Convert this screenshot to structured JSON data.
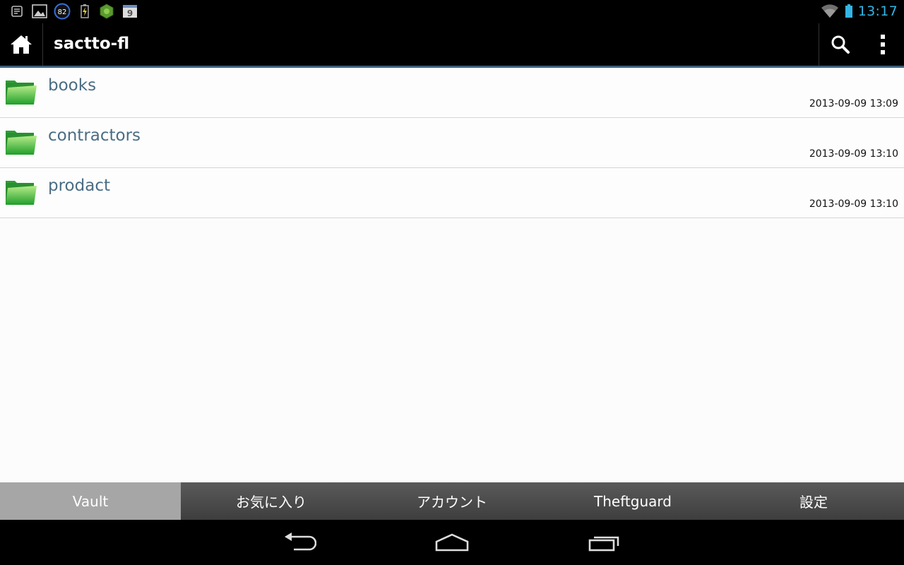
{
  "status_bar": {
    "icons": [
      "list-notification-icon",
      "image-notification-icon",
      "circle-82-icon",
      "battery-charging-icon",
      "app-green-icon",
      "calendar-icon"
    ],
    "badge_value": "82",
    "calendar_day": "9",
    "clock": "13:17",
    "accent": "#33b5e5"
  },
  "action_bar": {
    "title": "sactto-fl"
  },
  "files": [
    {
      "name": "books",
      "date": "2013-09-09 13:09"
    },
    {
      "name": "contractors",
      "date": "2013-09-09 13:10"
    },
    {
      "name": "prodact",
      "date": "2013-09-09 13:10"
    }
  ],
  "tabs": [
    {
      "label": "Vault",
      "active": true
    },
    {
      "label": "お気に入り",
      "active": false
    },
    {
      "label": "アカウント",
      "active": false
    },
    {
      "label": "Theftguard",
      "active": false
    },
    {
      "label": "設定",
      "active": false
    }
  ],
  "colors": {
    "folder_green": "#3cbf3c",
    "file_name": "#4a6d83",
    "active_tab": "#a6a6a6"
  }
}
